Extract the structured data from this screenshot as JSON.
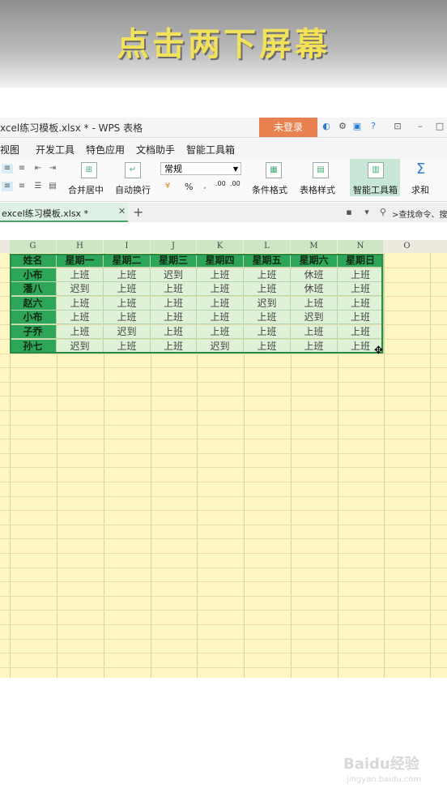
{
  "banner": {
    "text": "点击两下屏幕"
  },
  "titlebar": {
    "title": "xcel练习模板.xlsx * - WPS 表格",
    "login": "未登录"
  },
  "menu": {
    "items": [
      "视图",
      "开发工具",
      "特色应用",
      "文档助手",
      "智能工具箱"
    ]
  },
  "ribbon": {
    "merge_center": "合并居中",
    "auto_wrap": "自动换行",
    "number_format": "常规",
    "cond_format": "条件格式",
    "table_style": "表格样式",
    "smart_toolbox": "智能工具箱",
    "sum": "求和",
    "percent": "%",
    "dec_inc": ".00",
    "dec_dec": ".00"
  },
  "tabs": {
    "doc": "excel练习模板.xlsx *",
    "search": ">查找命令、搜"
  },
  "columns": [
    "G",
    "H",
    "I",
    "J",
    "K",
    "L",
    "M",
    "N",
    "O"
  ],
  "table": {
    "header": [
      "姓名",
      "星期一",
      "星期二",
      "星期三",
      "星期四",
      "星期五",
      "星期六",
      "星期日"
    ],
    "rows": [
      [
        "小布",
        "上班",
        "上班",
        "迟到",
        "上班",
        "上班",
        "休班",
        "上班"
      ],
      [
        "潘八",
        "迟到",
        "上班",
        "上班",
        "上班",
        "上班",
        "休班",
        "上班"
      ],
      [
        "赵六",
        "上班",
        "上班",
        "上班",
        "上班",
        "迟到",
        "上班",
        "上班"
      ],
      [
        "小布",
        "上班",
        "上班",
        "上班",
        "上班",
        "上班",
        "迟到",
        "上班"
      ],
      [
        "子乔",
        "上班",
        "迟到",
        "上班",
        "上班",
        "上班",
        "上班",
        "上班"
      ],
      [
        "孙七",
        "迟到",
        "上班",
        "上班",
        "迟到",
        "上班",
        "上班",
        "上班"
      ]
    ]
  },
  "watermark": {
    "main": "Baidu经验",
    "sub": "jingyan.baidu.com"
  },
  "colors": {
    "header_green": "#2ea65a",
    "cell_green": "#dff2d8",
    "sheet_yellow": "#fff7c2",
    "login_orange": "#e8804f"
  }
}
